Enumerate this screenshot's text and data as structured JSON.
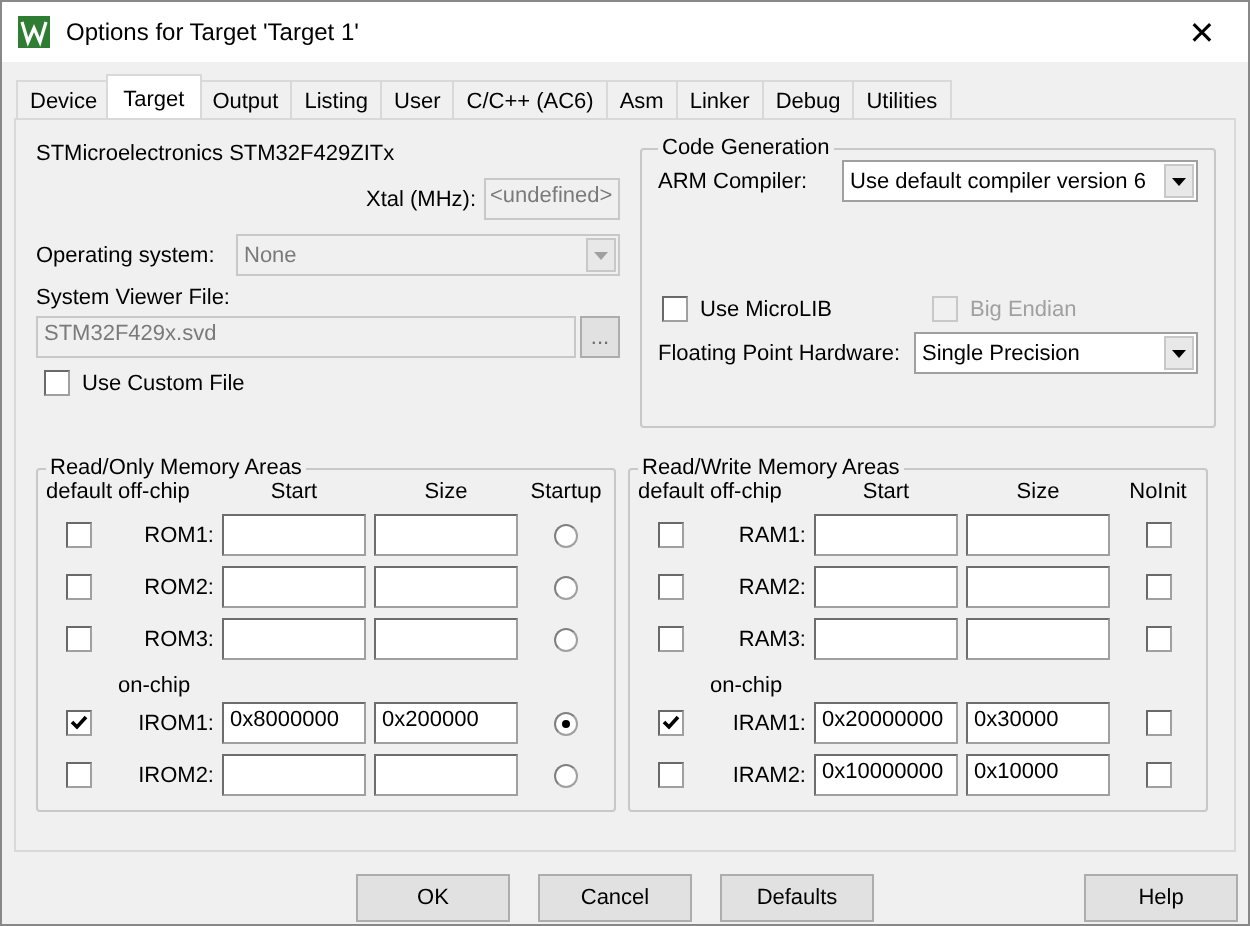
{
  "window": {
    "title": "Options for Target 'Target 1'",
    "close_label": "✕"
  },
  "tabs": [
    {
      "label": "Device",
      "selected": false
    },
    {
      "label": "Target",
      "selected": true
    },
    {
      "label": "Output",
      "selected": false
    },
    {
      "label": "Listing",
      "selected": false
    },
    {
      "label": "User",
      "selected": false
    },
    {
      "label": "C/C++ (AC6)",
      "selected": false
    },
    {
      "label": "Asm",
      "selected": false
    },
    {
      "label": "Linker",
      "selected": false
    },
    {
      "label": "Debug",
      "selected": false
    },
    {
      "label": "Utilities",
      "selected": false
    }
  ],
  "device": {
    "name": "STMicroelectronics STM32F429ZITx",
    "xtal_label": "Xtal (MHz):",
    "xtal_value": "<undefined>",
    "os_label": "Operating system:",
    "os_value": "None",
    "os_disabled": true,
    "svf_label": "System Viewer File:",
    "svf_value": "STM32F429x.svd",
    "svf_disabled": true,
    "browse_label": "...",
    "custom_file": {
      "label": "Use Custom File",
      "checked": false
    }
  },
  "code_generation": {
    "title": "Code Generation",
    "compiler_label": "ARM Compiler:",
    "compiler_value": "Use default compiler version 6",
    "microlib": {
      "label": "Use MicroLIB",
      "checked": false,
      "disabled": false
    },
    "big_endian": {
      "label": "Big Endian",
      "checked": false,
      "disabled": true
    },
    "fpu_label": "Floating Point Hardware:",
    "fpu_value": "Single Precision"
  },
  "memory_groups": [
    {
      "title": "Read/Only Memory Areas",
      "kind": "radio",
      "columns": [
        "default",
        "off-chip",
        "Start",
        "Size",
        "Startup"
      ],
      "on_chip_label": "on-chip",
      "off_chip_rows": [
        {
          "default": false,
          "name": "ROM1:",
          "selected": false
        },
        {
          "default": false,
          "name": "ROM2:",
          "selected": false
        },
        {
          "default": false,
          "name": "ROM3:",
          "selected": false
        }
      ],
      "on_chip_rows": [
        {
          "default": true,
          "name": "IROM1:",
          "start": "0x8000000",
          "size": "0x200000",
          "selected": true
        },
        {
          "default": false,
          "name": "IROM2:",
          "selected": false
        }
      ]
    },
    {
      "title": "Read/Write Memory Areas",
      "kind": "checkbox",
      "columns": [
        "default",
        "off-chip",
        "Start",
        "Size",
        "NoInit"
      ],
      "on_chip_label": "on-chip",
      "off_chip_rows": [
        {
          "default": false,
          "name": "RAM1:",
          "no_init": false
        },
        {
          "default": false,
          "name": "RAM2:",
          "no_init": false
        },
        {
          "default": false,
          "name": "RAM3:",
          "no_init": false
        }
      ],
      "on_chip_rows": [
        {
          "default": true,
          "name": "IRAM1:",
          "start": "0x20000000",
          "size": "0x30000",
          "no_init": false
        },
        {
          "default": false,
          "name": "IRAM2:",
          "start": "0x10000000",
          "size": "0x10000",
          "no_init": false
        }
      ]
    }
  ],
  "buttons": [
    {
      "label": "OK"
    },
    {
      "label": "Cancel"
    },
    {
      "label": "Defaults"
    },
    {
      "label": "Help"
    }
  ]
}
